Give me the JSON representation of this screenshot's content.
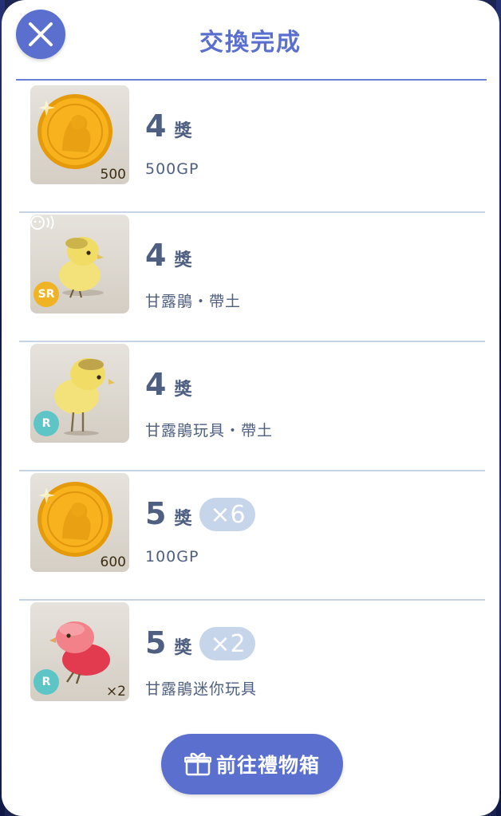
{
  "header": {
    "title": "交換完成"
  },
  "items": [
    {
      "prize_num": "4",
      "prize_word": "獎",
      "name": "500GP",
      "thumb_label": "500",
      "count": ""
    },
    {
      "prize_num": "4",
      "prize_word": "獎",
      "name": "甘露鵑・帶土",
      "rarity": "SR",
      "count": ""
    },
    {
      "prize_num": "4",
      "prize_word": "獎",
      "name": "甘露鵑玩具・帶土",
      "rarity": "R",
      "count": ""
    },
    {
      "prize_num": "5",
      "prize_word": "獎",
      "name": "100GP",
      "thumb_label": "600",
      "count": "×6"
    },
    {
      "prize_num": "5",
      "prize_word": "獎",
      "name": "甘露鵑迷你玩具",
      "rarity": "R",
      "thumb_label": "×2",
      "count": "×2"
    }
  ],
  "footer": {
    "gift_button_label": "前往禮物箱"
  },
  "colors": {
    "accent": "#5b6fce",
    "text": "#4e5f82",
    "pill": "#c6d5ea",
    "divider": "#c7d3e6"
  }
}
